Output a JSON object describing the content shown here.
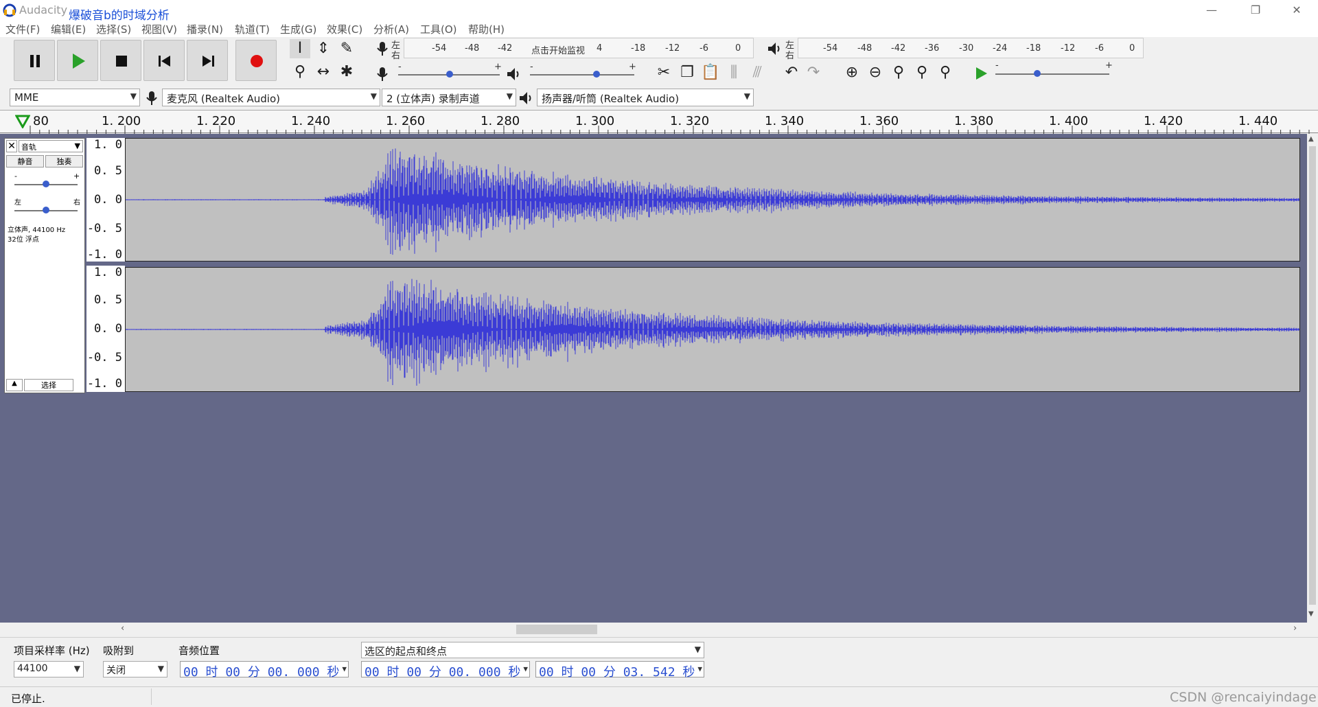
{
  "window": {
    "app_name": "Audacity",
    "title": "爆破音b的时域分析",
    "minimize": "—",
    "restore": "❐",
    "close": "✕"
  },
  "menu": [
    "文件(F)",
    "编辑(E)",
    "选择(S)",
    "视图(V)",
    "播录(N)",
    "轨道(T)",
    "生成(G)",
    "效果(C)",
    "分析(A)",
    "工具(O)",
    "帮助(H)"
  ],
  "meters": {
    "record": {
      "lr_top": "左",
      "lr_bottom": "右",
      "ticks": [
        "-54",
        "-48",
        "-42",
        "点击开始监视",
        "4",
        "-18",
        "-12",
        "-6",
        "0"
      ]
    },
    "play": {
      "lr_top": "左",
      "lr_bottom": "右",
      "ticks": [
        "-54",
        "-48",
        "-42",
        "-36",
        "-30",
        "-24",
        "-18",
        "-12",
        "-6",
        "0"
      ]
    }
  },
  "mixer": {
    "minus": "-",
    "plus": "+"
  },
  "device": {
    "host": "MME",
    "mic": "麦克风 (Realtek Audio)",
    "channels": "2 (立体声) 录制声道",
    "speaker": "扬声器/听筒 (Realtek Audio)"
  },
  "ruler": {
    "labels": [
      "80",
      "1. 200",
      "1. 220",
      "1. 240",
      "1. 260",
      "1. 280",
      "1. 300",
      "1. 320",
      "1. 340",
      "1. 360",
      "1. 380",
      "1. 400",
      "1. 420",
      "1. 440"
    ]
  },
  "track": {
    "name": "音轨",
    "mute": "静音",
    "solo": "独奏",
    "gain_minus": "-",
    "gain_plus": "+",
    "pan_left": "左",
    "pan_right": "右",
    "info_line1": "立体声, 44100 Hz",
    "info_line2": "32位 浮点",
    "select": "选择",
    "scale": [
      "1. 0",
      "0. 5",
      "0. 0",
      "-0. 5",
      "-1. 0"
    ]
  },
  "selection_toolbar": {
    "rate_label": "项目采样率 (Hz)",
    "rate_value": "44100",
    "snap_label": "吸附到",
    "snap_value": "关闭",
    "audio_pos_label": "音频位置",
    "audio_pos_value": "00 时 00 分 00. 000 秒",
    "sel_label": "选区的起点和终点",
    "sel_start": "00 时 00 分 00. 000 秒",
    "sel_end": "00 时 00 分 03. 542 秒"
  },
  "status": {
    "text": "已停止.",
    "watermark": "CSDN @rencaiyindage"
  },
  "colors": {
    "waveform": "#3b3bd6",
    "track_bg": "#c0c0c0",
    "area_bg": "#646888",
    "title_blue": "#1a4fd8"
  }
}
